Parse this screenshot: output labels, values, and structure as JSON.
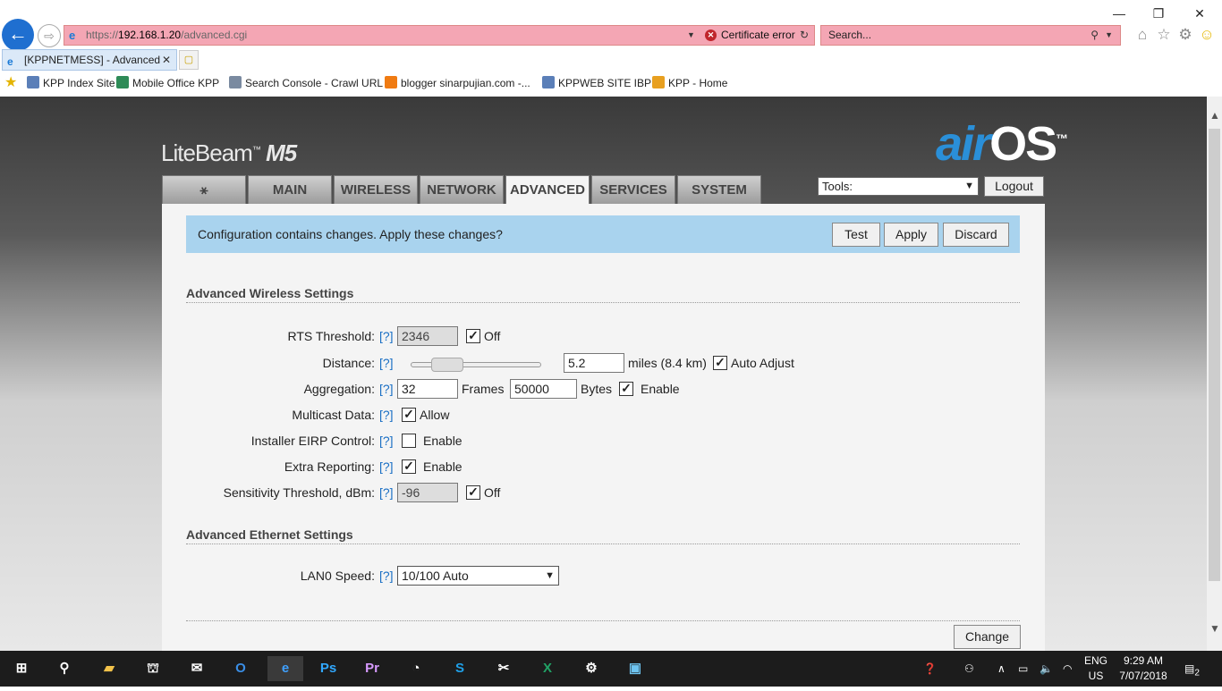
{
  "browser": {
    "url_scheme": "https://",
    "url_host": "192.168.1.20",
    "url_path": "/advanced.cgi",
    "cert_error": "Certificate error",
    "search_placeholder": "Search...",
    "tab_title": "[KPPNETMESS] - Advanced",
    "window_minimize": "—",
    "window_restore": "❐",
    "window_close": "✕",
    "favorites": [
      {
        "label": "KPP Index Site",
        "color": "#5b7fb8"
      },
      {
        "label": "Mobile Office KPP",
        "color": "#2e8b57"
      },
      {
        "label": "Search Console - Crawl URL",
        "color": "#7a8aa0"
      },
      {
        "label": "blogger sinarpujian.com -...",
        "color": "#f07b12"
      },
      {
        "label": "KPPWEB SITE IBPL",
        "color": "#5b7fb8"
      },
      {
        "label": "KPP - Home",
        "color": "#e8a020"
      }
    ]
  },
  "app": {
    "brand": "LiteBeam",
    "brand_tm": "™",
    "brand_model": "M5",
    "logo_air": "air",
    "logo_os": "OS",
    "logo_tm": "™",
    "tabs": [
      {
        "label": "⚹",
        "active": false
      },
      {
        "label": "MAIN",
        "active": false
      },
      {
        "label": "WIRELESS",
        "active": false
      },
      {
        "label": "NETWORK",
        "active": false
      },
      {
        "label": "ADVANCED",
        "active": true
      },
      {
        "label": "SERVICES",
        "active": false
      },
      {
        "label": "SYSTEM",
        "active": false
      }
    ],
    "tools_select": "Tools:",
    "logout": "Logout"
  },
  "notice": {
    "text": "Configuration contains changes. Apply these changes?",
    "test": "Test",
    "apply": "Apply",
    "discard": "Discard"
  },
  "wireless": {
    "heading": "Advanced Wireless Settings",
    "help": "[?]",
    "rts_label": "RTS Threshold:",
    "rts_value": "2346",
    "rts_off_label": "Off",
    "rts_off": true,
    "distance_label": "Distance:",
    "distance_slider": 0.2,
    "distance_value": "5.2",
    "distance_unit": "miles (8.4 km)",
    "auto_adjust_label": "Auto Adjust",
    "auto_adjust": true,
    "aggregation_label": "Aggregation:",
    "aggregation_frames": "32",
    "frames_label": "Frames",
    "aggregation_bytes": "50000",
    "bytes_label": "Bytes",
    "aggregation_enable_label": "Enable",
    "aggregation_enable": true,
    "multicast_label": "Multicast Data:",
    "multicast_allow_label": "Allow",
    "multicast_allow": true,
    "eirp_label": "Installer EIRP Control:",
    "eirp_enable_label": "Enable",
    "eirp_enable": false,
    "extra_label": "Extra Reporting:",
    "extra_enable_label": "Enable",
    "extra_enable": true,
    "sens_label": "Sensitivity Threshold, dBm:",
    "sens_value": "-96",
    "sens_off_label": "Off",
    "sens_off": true
  },
  "ethernet": {
    "heading": "Advanced Ethernet Settings",
    "lan0_label": "LAN0 Speed:",
    "lan0_value": "10/100 Auto"
  },
  "change_button": "Change",
  "taskbar": {
    "lang": "ENG",
    "region": "US",
    "time": "9:29 AM",
    "date": "7/07/2018",
    "notifications": "2"
  }
}
